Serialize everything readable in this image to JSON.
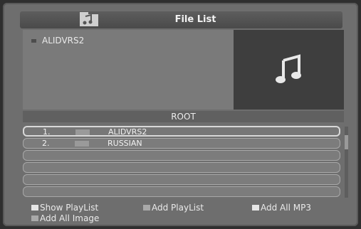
{
  "header": {
    "title": "File List",
    "icon": "folder-note-icon"
  },
  "info": {
    "current_item": "ALIDVRS2"
  },
  "preview": {
    "icon": "music-note-icon"
  },
  "directory": {
    "label": "ROOT"
  },
  "list": {
    "rows": [
      {
        "num": "1.",
        "name": "ALIDVRS2",
        "selected": true
      },
      {
        "num": "2.",
        "name": "RUSSIAN",
        "selected": false
      },
      {
        "num": "",
        "name": "",
        "selected": false
      },
      {
        "num": "",
        "name": "",
        "selected": false
      },
      {
        "num": "",
        "name": "",
        "selected": false
      },
      {
        "num": "",
        "name": "",
        "selected": false
      }
    ]
  },
  "options": {
    "show_playlist": "Show PlayList",
    "add_playlist": "Add PlayList",
    "add_all_mp3": "Add All MP3",
    "add_all_image": "Add All Image"
  }
}
